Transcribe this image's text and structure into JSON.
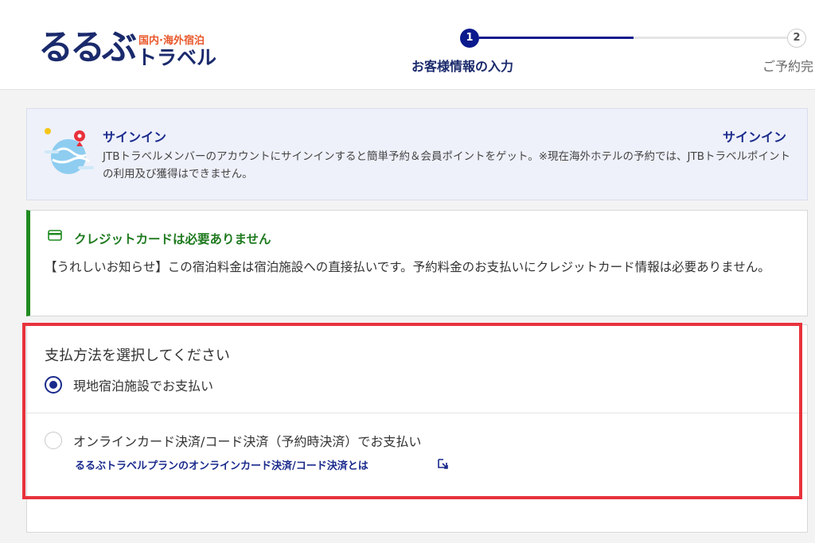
{
  "header": {
    "logo_main": "るるぶ",
    "logo_sub": "国内·海外宿泊",
    "logo_travel": "トラベル",
    "steps": [
      {
        "number": "1",
        "label": "お客様情報の入力",
        "active": true
      },
      {
        "number": "2",
        "label": "ご予約完",
        "active": false
      }
    ],
    "progress": 0.5
  },
  "signin": {
    "title": "サインイン",
    "link": "サインイン",
    "description": "JTBトラベルメンバーのアカウントにサインインすると簡単予約＆会員ポイントをゲット。※現在海外ホテルの予約では、JTBトラベルポイントの利用及び獲得はできません。"
  },
  "notice": {
    "title": "クレジットカードは必要ありません",
    "description": "【うれしいお知らせ】この宿泊料金は宿泊施設への直接払いです。予約料金のお支払いにクレジットカード情報は必要ありません。"
  },
  "payment": {
    "heading": "支払方法を選択してください",
    "options": [
      {
        "label": "現地宿泊施設でお支払い",
        "selected": true
      },
      {
        "label": "オンラインカード決済/コード決済（予約時決済）でお支払い",
        "selected": false
      }
    ],
    "info_link": "るるぶトラベルプランのオンラインカード決済/コード決済とは"
  },
  "colors": {
    "brand_navy": "#1a2a6c",
    "accent_orange": "#e8582b",
    "notice_green": "#1f8a20",
    "highlight_red": "#e8323c"
  }
}
